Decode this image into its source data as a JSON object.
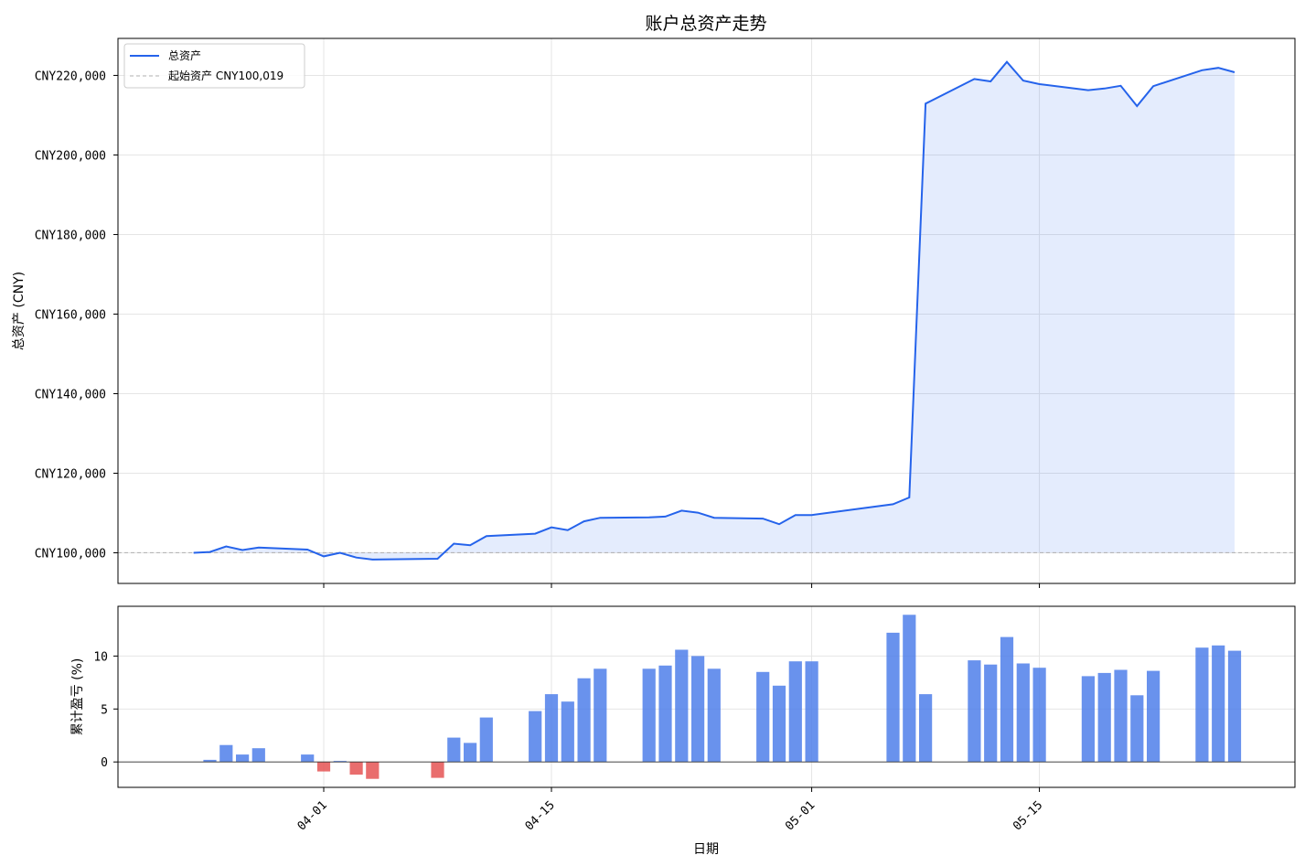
{
  "chart_data": [
    {
      "type": "area",
      "title": "账户总资产走势",
      "ylabel": "总资产 (CNY)",
      "xlabel": "",
      "ylim": [
        92300,
        229300
      ],
      "yticks": [
        100000,
        120000,
        140000,
        160000,
        180000,
        200000,
        220000
      ],
      "ytick_labels": [
        "CNY100,000",
        "CNY120,000",
        "CNY140,000",
        "CNY160,000",
        "CNY180,000",
        "CNY200,000",
        "CNY220,000"
      ],
      "grid": true,
      "legend_position": "upper-left",
      "legend": [
        "总资产",
        "起始资产 CNY100,019"
      ],
      "baseline": 100019,
      "series": [
        {
          "name": "总资产",
          "color": "#2563eb",
          "points": [
            [
              "2024-03-24",
              100000
            ],
            [
              "2024-03-25",
              100200
            ],
            [
              "2024-03-26",
              101600
            ],
            [
              "2024-03-27",
              100700
            ],
            [
              "2024-03-28",
              101300
            ],
            [
              "2024-03-31",
              100800
            ],
            [
              "2024-03-31",
              100800
            ],
            [
              "2024-04-01",
              99100
            ],
            [
              "2024-04-02",
              100000
            ],
            [
              "2024-04-03",
              98800
            ],
            [
              "2024-04-04",
              98300
            ],
            [
              "2024-04-08",
              98500
            ],
            [
              "2024-04-08",
              98500
            ],
            [
              "2024-04-09",
              102300
            ],
            [
              "2024-04-10",
              101900
            ],
            [
              "2024-04-11",
              104200
            ],
            [
              "2024-04-14",
              104800
            ],
            [
              "2024-04-14",
              104800
            ],
            [
              "2024-04-15",
              106400
            ],
            [
              "2024-04-16",
              105700
            ],
            [
              "2024-04-17",
              107900
            ],
            [
              "2024-04-18",
              108800
            ],
            [
              "2024-04-21",
              108900
            ],
            [
              "2024-04-21",
              108900
            ],
            [
              "2024-04-22",
              109100
            ],
            [
              "2024-04-23",
              110600
            ],
            [
              "2024-04-24",
              110100
            ],
            [
              "2024-04-25",
              108800
            ],
            [
              "2024-04-28",
              108600
            ],
            [
              "2024-04-28",
              108600
            ],
            [
              "2024-04-29",
              107200
            ],
            [
              "2024-04-30",
              109500
            ],
            [
              "2024-05-01",
              109500
            ],
            [
              "2024-05-06",
              112200
            ],
            [
              "2024-05-07",
              113900
            ],
            [
              "2024-05-08",
              212900
            ],
            [
              "2024-05-11",
              219100
            ],
            [
              "2024-05-12",
              218500
            ],
            [
              "2024-05-13",
              223400
            ],
            [
              "2024-05-14",
              218700
            ],
            [
              "2024-05-15",
              217800
            ],
            [
              "2024-05-18",
              216300
            ],
            [
              "2024-05-19",
              216700
            ],
            [
              "2024-05-20",
              217400
            ],
            [
              "2024-05-21",
              212300
            ],
            [
              "2024-05-22",
              217300
            ],
            [
              "2024-05-25",
              221300
            ],
            [
              "2024-05-26",
              221900
            ],
            [
              "2024-05-27",
              220800
            ]
          ]
        }
      ]
    },
    {
      "type": "bar",
      "xlabel": "日期",
      "ylabel": "累计盈亏 (%)",
      "ylim": [
        -2.4,
        14.7
      ],
      "yticks": [
        0,
        5,
        10
      ],
      "ytick_labels": [
        "0",
        "5",
        "10"
      ],
      "xticks": [
        "2024-04-01",
        "2024-04-15",
        "2024-05-01",
        "2024-05-15"
      ],
      "xtick_labels": [
        "04-01",
        "04-15",
        "05-01",
        "05-15"
      ],
      "grid": true,
      "positive_color": "#4f7fea",
      "negative_color": "#e55353",
      "bars": [
        [
          "2024-03-25",
          0.2
        ],
        [
          "2024-03-26",
          1.6
        ],
        [
          "2024-03-27",
          0.7
        ],
        [
          "2024-03-28",
          1.3
        ],
        [
          "2024-03-31",
          0.7
        ],
        [
          "2024-04-01",
          -0.9
        ],
        [
          "2024-04-02",
          0.1
        ],
        [
          "2024-04-03",
          -1.2
        ],
        [
          "2024-04-04",
          -1.6
        ],
        [
          "2024-04-08",
          -1.5
        ],
        [
          "2024-04-09",
          2.3
        ],
        [
          "2024-04-10",
          1.8
        ],
        [
          "2024-04-11",
          4.2
        ],
        [
          "2024-04-14",
          4.8
        ],
        [
          "2024-04-15",
          6.4
        ],
        [
          "2024-04-16",
          5.7
        ],
        [
          "2024-04-17",
          7.9
        ],
        [
          "2024-04-18",
          8.8
        ],
        [
          "2024-04-21",
          8.8
        ],
        [
          "2024-04-22",
          9.1
        ],
        [
          "2024-04-23",
          10.6
        ],
        [
          "2024-04-24",
          10.0
        ],
        [
          "2024-04-25",
          8.8
        ],
        [
          "2024-04-28",
          8.5
        ],
        [
          "2024-04-29",
          7.2
        ],
        [
          "2024-04-30",
          9.5
        ],
        [
          "2024-05-01",
          9.5
        ],
        [
          "2024-05-06",
          12.2
        ],
        [
          "2024-05-07",
          13.9
        ],
        [
          "2024-05-08",
          6.4
        ],
        [
          "2024-05-11",
          9.6
        ],
        [
          "2024-05-12",
          9.2
        ],
        [
          "2024-05-13",
          11.8
        ],
        [
          "2024-05-14",
          9.3
        ],
        [
          "2024-05-15",
          8.9
        ],
        [
          "2024-05-18",
          8.1
        ],
        [
          "2024-05-19",
          8.4
        ],
        [
          "2024-05-20",
          8.7
        ],
        [
          "2024-05-21",
          6.3
        ],
        [
          "2024-05-22",
          8.6
        ],
        [
          "2024-05-25",
          10.8
        ],
        [
          "2024-05-26",
          11.0
        ],
        [
          "2024-05-27",
          10.5
        ]
      ]
    }
  ]
}
